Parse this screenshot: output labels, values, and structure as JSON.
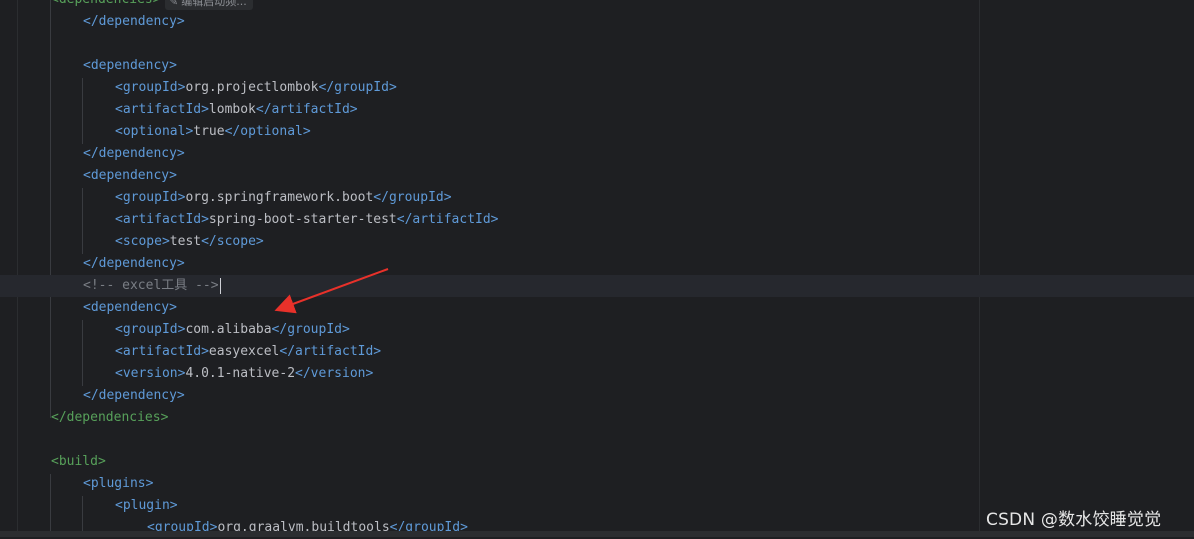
{
  "inlay_hint": {
    "icon": "edit-icon",
    "label": "编辑启动频..."
  },
  "lines": [
    {
      "indent": 1,
      "parts": [
        {
          "c": "tag",
          "t": "</dependency>"
        }
      ]
    },
    {
      "indent": 0,
      "parts": []
    },
    {
      "indent": 1,
      "parts": [
        {
          "c": "tag",
          "t": "<dependency>"
        }
      ]
    },
    {
      "indent": 2,
      "parts": [
        {
          "c": "tag",
          "t": "<groupId>"
        },
        {
          "c": "text",
          "t": "org.projectlombok"
        },
        {
          "c": "tag",
          "t": "</groupId>"
        }
      ]
    },
    {
      "indent": 2,
      "parts": [
        {
          "c": "tag",
          "t": "<artifactId>"
        },
        {
          "c": "text",
          "t": "lombok"
        },
        {
          "c": "tag",
          "t": "</artifactId>"
        }
      ]
    },
    {
      "indent": 2,
      "parts": [
        {
          "c": "tag",
          "t": "<optional>"
        },
        {
          "c": "text",
          "t": "true"
        },
        {
          "c": "tag",
          "t": "</optional>"
        }
      ]
    },
    {
      "indent": 1,
      "parts": [
        {
          "c": "tag",
          "t": "</dependency>"
        }
      ]
    },
    {
      "indent": 1,
      "parts": [
        {
          "c": "tag",
          "t": "<dependency>"
        }
      ]
    },
    {
      "indent": 2,
      "parts": [
        {
          "c": "tag",
          "t": "<groupId>"
        },
        {
          "c": "text",
          "t": "org.springframework.boot"
        },
        {
          "c": "tag",
          "t": "</groupId>"
        }
      ]
    },
    {
      "indent": 2,
      "parts": [
        {
          "c": "tag",
          "t": "<artifactId>"
        },
        {
          "c": "text",
          "t": "spring-boot-starter-test"
        },
        {
          "c": "tag",
          "t": "</artifactId>"
        }
      ]
    },
    {
      "indent": 2,
      "parts": [
        {
          "c": "tag",
          "t": "<scope>"
        },
        {
          "c": "text",
          "t": "test"
        },
        {
          "c": "tag",
          "t": "</scope>"
        }
      ]
    },
    {
      "indent": 1,
      "parts": [
        {
          "c": "tag",
          "t": "</dependency>"
        }
      ]
    },
    {
      "indent": 1,
      "current": true,
      "caret": true,
      "parts": [
        {
          "c": "comment",
          "t": "<!-- excel工具 -->"
        }
      ]
    },
    {
      "indent": 1,
      "parts": [
        {
          "c": "tag",
          "t": "<dependency>"
        }
      ]
    },
    {
      "indent": 2,
      "parts": [
        {
          "c": "tag",
          "t": "<groupId>"
        },
        {
          "c": "text",
          "t": "com.alibaba"
        },
        {
          "c": "tag",
          "t": "</groupId>"
        }
      ]
    },
    {
      "indent": 2,
      "parts": [
        {
          "c": "tag",
          "t": "<artifactId>"
        },
        {
          "c": "text",
          "t": "easyexcel"
        },
        {
          "c": "tag",
          "t": "</artifactId>"
        }
      ]
    },
    {
      "indent": 2,
      "parts": [
        {
          "c": "tag",
          "t": "<version>"
        },
        {
          "c": "text",
          "t": "4.0.1-native-2"
        },
        {
          "c": "tag",
          "t": "</version>"
        }
      ]
    },
    {
      "indent": 1,
      "parts": [
        {
          "c": "tag",
          "t": "</dependency>"
        }
      ]
    },
    {
      "indent": 0,
      "parts": [
        {
          "c": "tag green",
          "t": "</dependencies>"
        }
      ]
    },
    {
      "indent": 0,
      "parts": []
    },
    {
      "indent": 0,
      "parts": [
        {
          "c": "tag green",
          "t": "<build>"
        }
      ]
    },
    {
      "indent": 1,
      "parts": [
        {
          "c": "tag",
          "t": "<plugins>"
        }
      ]
    },
    {
      "indent": 2,
      "parts": [
        {
          "c": "tag",
          "t": "<plugin>"
        }
      ]
    },
    {
      "indent": 3,
      "parts": [
        {
          "c": "tag",
          "t": "<groupId>"
        },
        {
          "c": "text",
          "t": "org.graalvm.buildtools"
        },
        {
          "c": "tag",
          "t": "</groupId>"
        }
      ]
    }
  ],
  "top_partial": {
    "parts": [
      {
        "c": "tag green",
        "t": "<dependencies>"
      }
    ]
  },
  "watermark": "CSDN @数水饺睡觉觉",
  "annotation": {
    "type": "red-arrow",
    "color": "#e8312a",
    "points_to": "<dependency> (easyexcel)"
  }
}
